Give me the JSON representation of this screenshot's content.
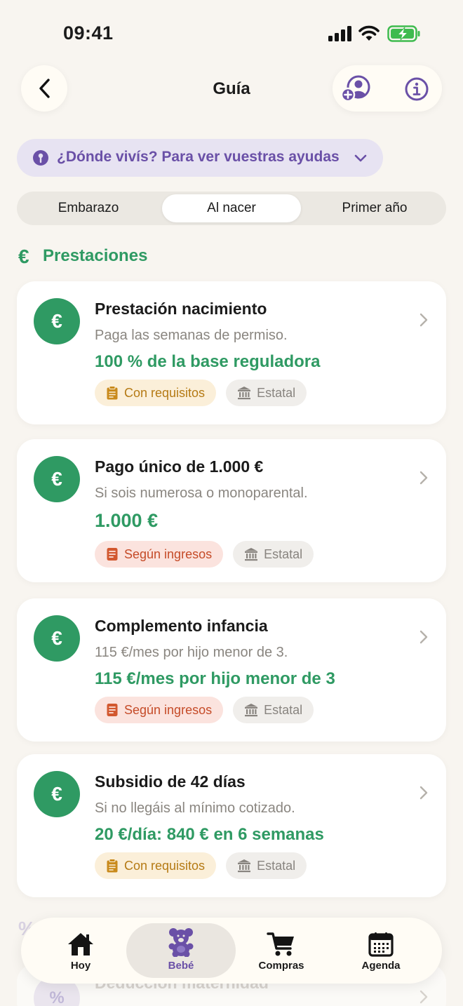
{
  "status_bar": {
    "time": "09:41"
  },
  "header": {
    "title": "Guía"
  },
  "region": {
    "label": "¿Dónde vivís? Para ver vuestras ayudas"
  },
  "tabs": [
    {
      "label": "Embarazo",
      "selected": false
    },
    {
      "label": "Al nacer",
      "selected": true
    },
    {
      "label": "Primer año",
      "selected": false
    }
  ],
  "section": {
    "icon": "€",
    "title": "Prestaciones"
  },
  "cards": [
    {
      "icon": "€",
      "title": "Prestación nacimiento",
      "description": "Paga las semanas de permiso.",
      "amount": "100 % de la base reguladora",
      "tags": [
        {
          "label": "Con requisitos",
          "style": "yellow",
          "icon": "clipboard-icon"
        },
        {
          "label": "Estatal",
          "style": "grey",
          "icon": "bank-icon"
        }
      ]
    },
    {
      "icon": "€",
      "title": "Pago único de 1.000 €",
      "description": "Si sois numerosa o monoparental.",
      "amount": "1.000 €",
      "tags": [
        {
          "label": "Según ingresos",
          "style": "red",
          "icon": "document-icon"
        },
        {
          "label": "Estatal",
          "style": "grey",
          "icon": "bank-icon"
        }
      ]
    },
    {
      "icon": "€",
      "title": "Complemento infancia",
      "description": "115 €/mes por hijo menor de 3.",
      "amount": "115 €/mes por hijo menor de 3",
      "tags": [
        {
          "label": "Según ingresos",
          "style": "red",
          "icon": "document-icon"
        },
        {
          "label": "Estatal",
          "style": "grey",
          "icon": "bank-icon"
        }
      ]
    },
    {
      "icon": "€",
      "title": "Subsidio de 42 días",
      "description": "Si no llegáis al mínimo cotizado.",
      "amount": "20 €/día: 840 € en 6 semanas",
      "tags": [
        {
          "label": "Con requisitos",
          "style": "yellow",
          "icon": "clipboard-icon"
        },
        {
          "label": "Estatal",
          "style": "grey",
          "icon": "bank-icon"
        }
      ]
    }
  ],
  "faded_section": {
    "icon": "%",
    "title": "Deducción maternidad"
  },
  "bottom_nav": [
    {
      "label": "Hoy",
      "icon": "home-icon",
      "active": false
    },
    {
      "label": "Bebé",
      "icon": "teddy-bear-icon",
      "active": true
    },
    {
      "label": "Compras",
      "icon": "cart-icon",
      "active": false
    },
    {
      "label": "Agenda",
      "icon": "calendar-icon",
      "active": false
    }
  ],
  "colors": {
    "background": "#f8f5f0",
    "accent_green": "#2f9a63",
    "accent_purple": "#6a50a7",
    "tag_yellow_text": "#b57a14",
    "tag_red_text": "#c54b28"
  }
}
